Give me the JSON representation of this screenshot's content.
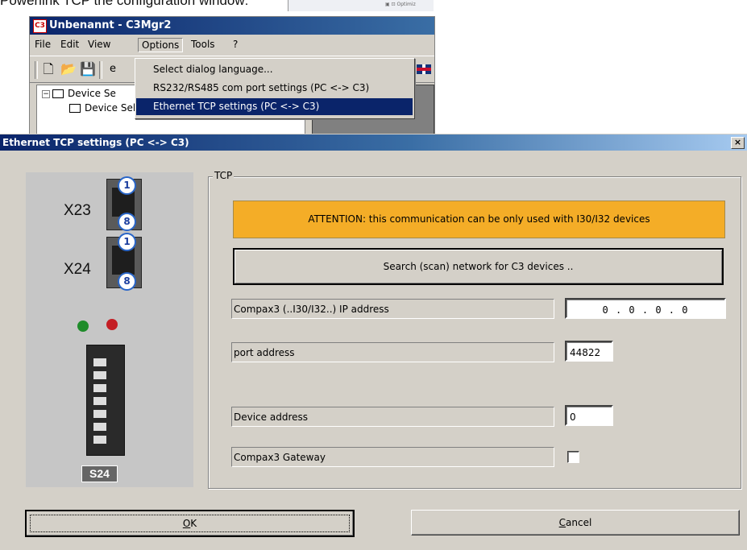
{
  "caption": "Powerlink TCP the configuration window:",
  "background_window": {
    "title": "Unbenannt - C3Mgr2",
    "menu": [
      "File",
      "Edit",
      "View",
      "Options",
      "Tools",
      "?"
    ],
    "tree": {
      "root": "Device Se",
      "child": "Device Selection Wizard"
    }
  },
  "options_menu": {
    "items": [
      "Select dialog language...",
      "RS232/RS485  com port settings (PC <-> C3)",
      "Ethernet TCP settings (PC <-> C3)"
    ],
    "highlighted_index": 2
  },
  "dialog": {
    "title": "Ethernet TCP settings (PC <-> C3)",
    "close": "×",
    "device_labels": {
      "x23": "X23",
      "x24": "X24",
      "pin1": "1",
      "pin8": "8",
      "s24": "S24"
    },
    "led_colors": [
      "#1f8c2a",
      "#c41e24"
    ],
    "group_label": "TCP",
    "attention": "ATTENTION: this communication can be only used with I30/I32 devices",
    "scan_button": "Search (scan) network for C3 devices ..",
    "fields": {
      "ip_label": "Compax3 (..I30/I32..) IP address",
      "ip_value": "0  .  0  .  0  .  0",
      "port_label": "port address",
      "port_value": "44822",
      "device_label": "Device address",
      "device_value": "0",
      "gateway_label": "Compax3 Gateway",
      "gateway_checked": false
    },
    "ok_button": {
      "prefix": "",
      "mnemonic": "O",
      "suffix": "K"
    },
    "cancel_button": {
      "prefix": "",
      "mnemonic": "C",
      "suffix": "ancel"
    }
  }
}
